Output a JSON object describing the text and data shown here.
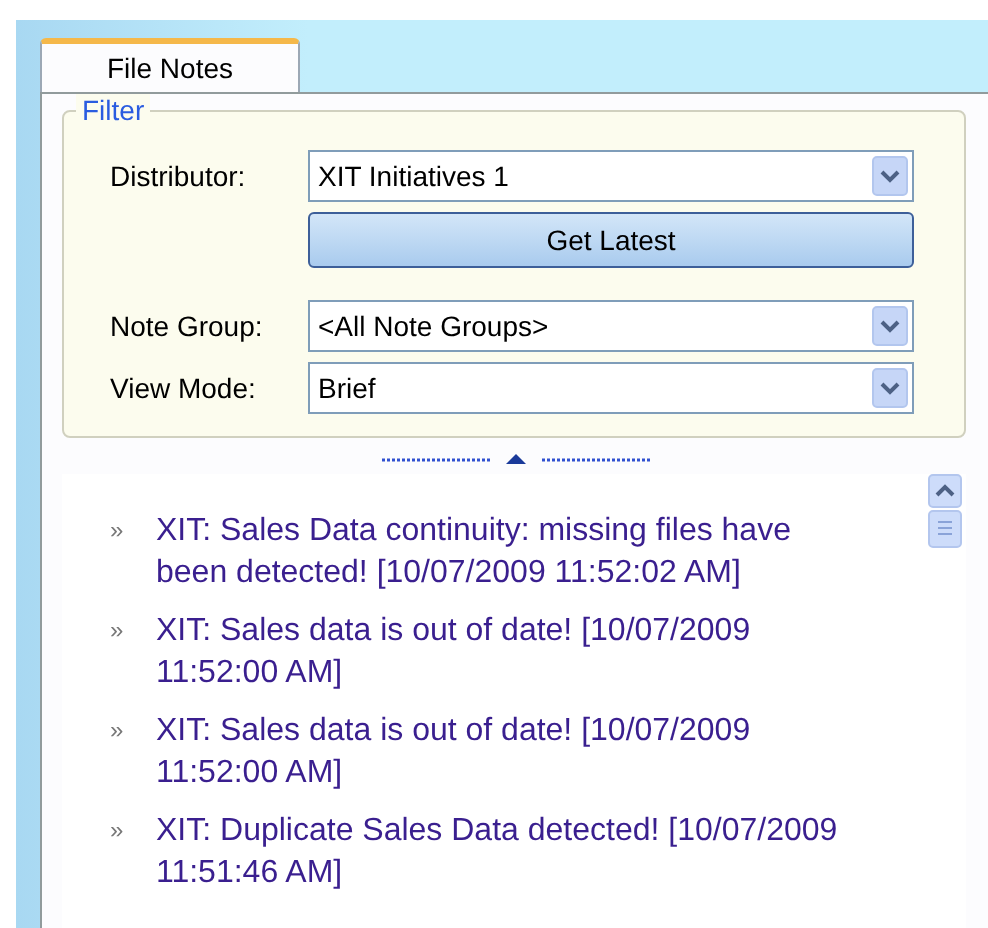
{
  "tabs": [
    {
      "label": "File Notes",
      "selected": true
    }
  ],
  "filter": {
    "title": "Filter",
    "fields": [
      {
        "label": "Distributor:",
        "value": "XIT Initiatives 1"
      },
      {
        "label": "Note Group:",
        "value": "<All Note Groups>"
      },
      {
        "label": "View Mode:",
        "value": "Brief"
      }
    ],
    "button": {
      "label": "Get Latest"
    }
  },
  "notes": [
    {
      "bullet": "»",
      "text": "XIT: Sales Data continuity: missing files have been detected! [10/07/2009 11:52:02 AM]"
    },
    {
      "bullet": "»",
      "text": "XIT: Sales data is out of date! [10/07/2009 11:52:00 AM]"
    },
    {
      "bullet": "»",
      "text": "XIT: Sales data is out of date! [10/07/2009 11:52:00 AM]"
    },
    {
      "bullet": "»",
      "text": "XIT: Duplicate Sales Data detected! [10/07/2009 11:51:46 AM]"
    }
  ]
}
